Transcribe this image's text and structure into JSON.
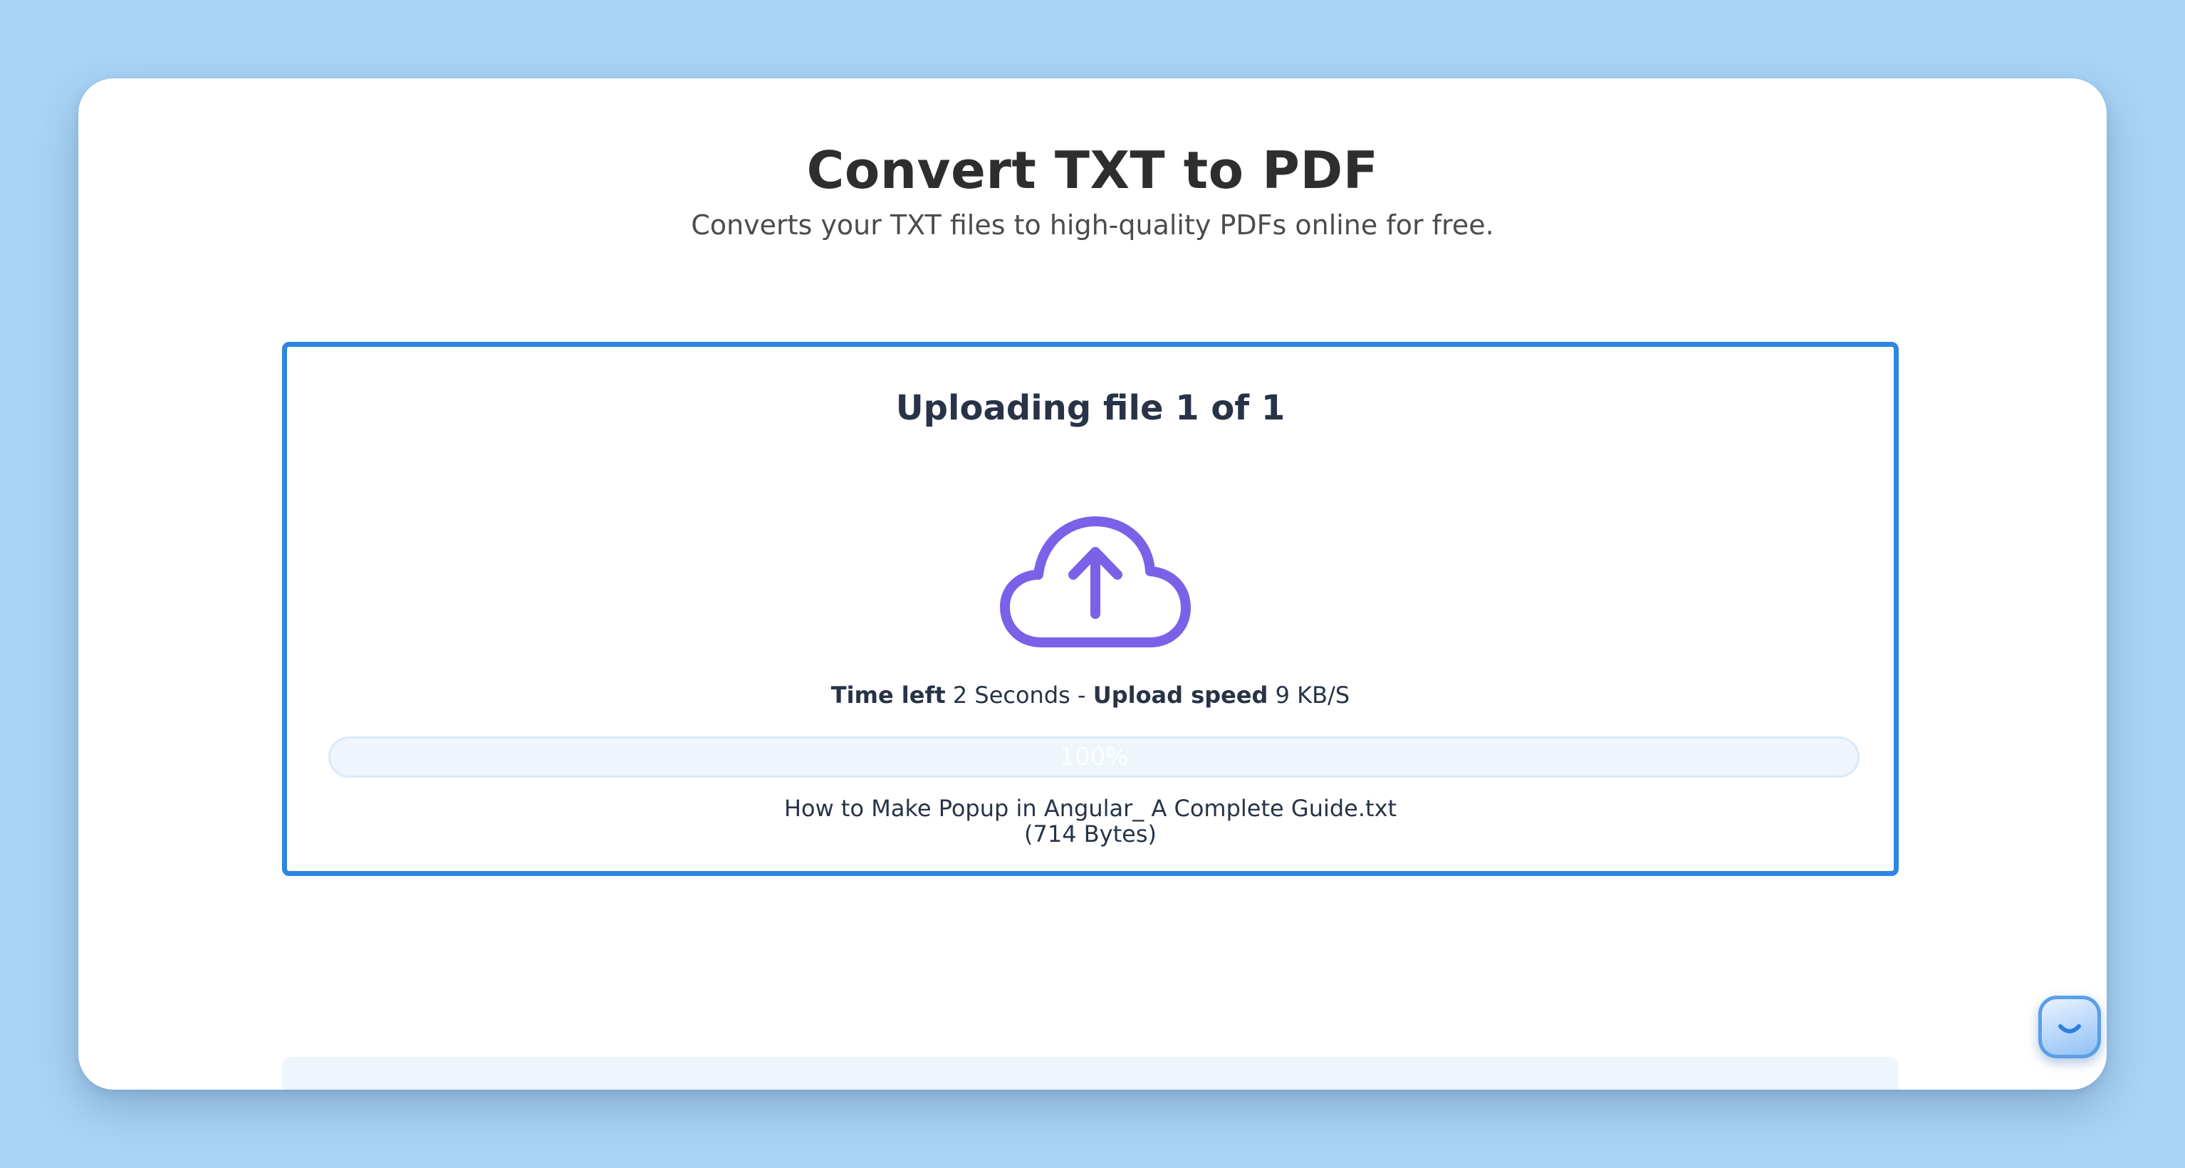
{
  "page": {
    "title": "Convert TXT to PDF",
    "subtitle": "Converts your TXT files to high-quality PDFs online for free."
  },
  "upload": {
    "heading": "Uploading file 1 of 1",
    "icon": "cloud-upload-icon",
    "time_left_label": "Time left",
    "time_left_value": "2 Seconds",
    "separator": "-",
    "speed_label": "Upload speed",
    "speed_value": "9 KB/S",
    "progress_text": "100%",
    "progress_fraction": 1.0,
    "file_name": "How to Make Popup in Angular_ A Complete Guide.txt",
    "file_size": "(714 Bytes)"
  },
  "chat_widget": {
    "icon": "chat-smile-icon"
  },
  "colors": {
    "background": "#a8d4f6",
    "accent_border": "#2d86e0",
    "icon_purple": "#7b61e8",
    "text_dark": "#283347"
  }
}
